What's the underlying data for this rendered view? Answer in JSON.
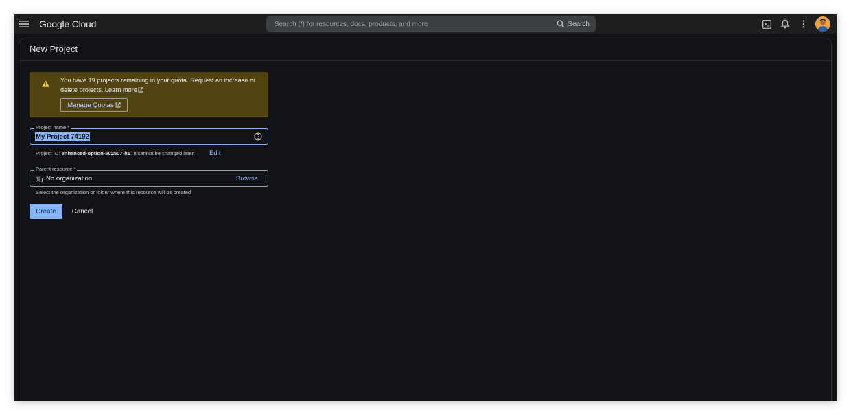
{
  "app": {
    "logo": "Google Cloud"
  },
  "search": {
    "placeholder": "Search (/) for resources, docs, products, and more",
    "button_label": "Search"
  },
  "toolbar": {
    "icons": [
      "cloud-shell-icon",
      "notifications-icon",
      "more-vert-icon"
    ]
  },
  "page": {
    "title": "New Project"
  },
  "warning": {
    "text": "You have 19 projects remaining in your quota. Request an increase or delete projects.",
    "learn_more": "Learn more",
    "manage_quotas": "Manage Quotas",
    "color": "#514410"
  },
  "project_name": {
    "label": "Project name *",
    "value": "My Project 74192"
  },
  "project_id": {
    "prefix": "Project ID:",
    "id": "enhanced-option-502507-h1",
    "suffix": ". It cannot be changed later.",
    "edit": "Edit"
  },
  "parent_resource": {
    "label": "Parent resource *",
    "value": "No organization",
    "browse": "Browse",
    "helper": "Select the organization or folder where this resource will be created"
  },
  "actions": {
    "create": "Create",
    "cancel": "Cancel"
  },
  "colors": {
    "accent": "#8ab4f8",
    "background": "#121317"
  }
}
